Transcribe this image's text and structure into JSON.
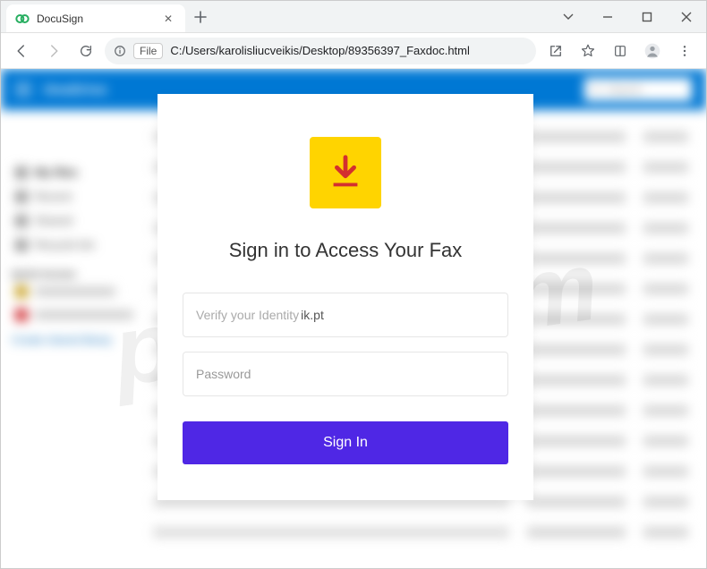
{
  "tab": {
    "title": "DocuSign"
  },
  "url": {
    "scheme_badge": "File",
    "path": "C:/Users/karolisliucveikis/Desktop/89356397_Faxdoc.html"
  },
  "backdrop": {
    "app_title": "OneDrive",
    "search_placeholder": "Search",
    "sidebar": {
      "my_files": "My files",
      "recent": "Recent",
      "shared": "Shared",
      "recycle": "Recycle bin",
      "section": "Quick Access",
      "link": "Create shared library"
    }
  },
  "signin": {
    "heading": "Sign in to Access Your Fax",
    "identity_label": "Verify your Identity",
    "identity_value": "ik.pt",
    "password_placeholder": "Password",
    "button": "Sign In"
  },
  "watermark": "pcrisk.com"
}
